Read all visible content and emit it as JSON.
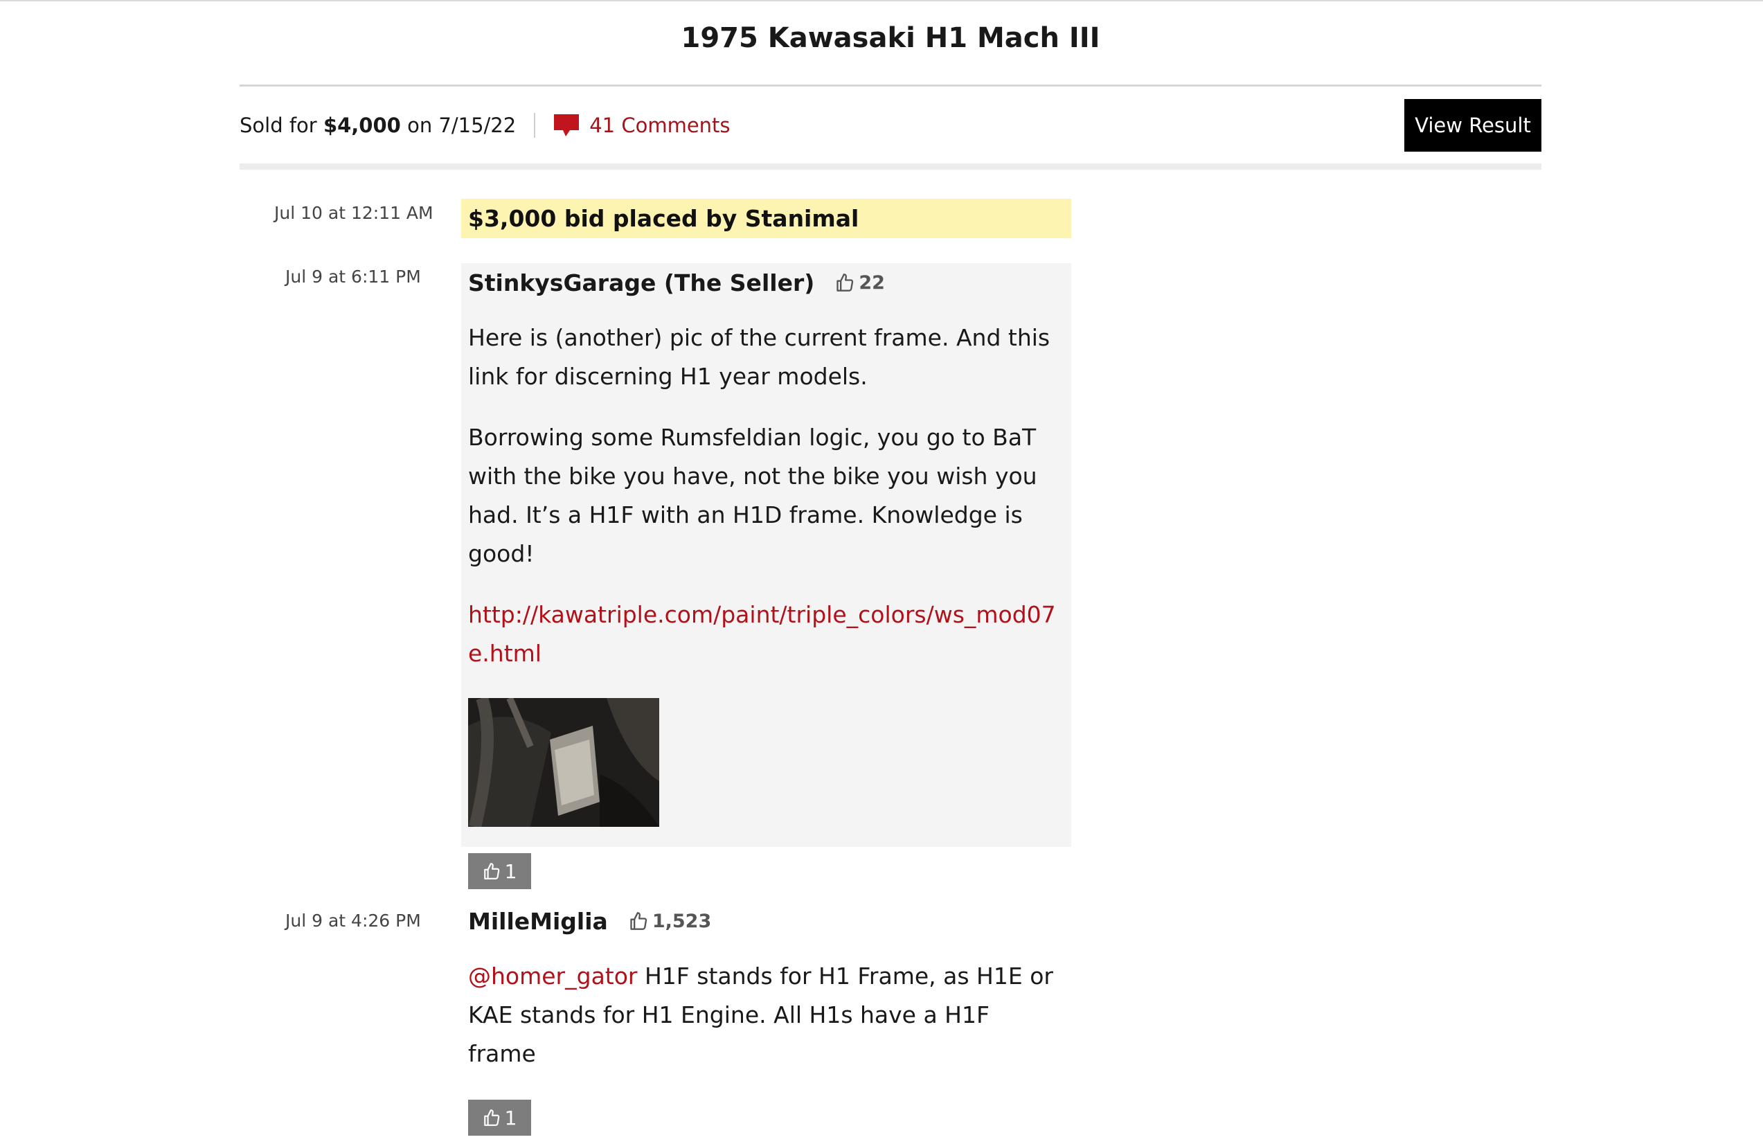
{
  "listing": {
    "title": "1975 Kawasaki H1 Mach III"
  },
  "result_bar": {
    "sold_prefix": "Sold for",
    "sold_price": "$4,000",
    "sold_on": "on 7/15/22",
    "comments_link": "41 Comments",
    "view_result_label": "View Result"
  },
  "bid_entry": {
    "time": "Jul 10 at 12:11 AM",
    "text": "$3,000 bid placed by Stanimal"
  },
  "comments": [
    {
      "time": "Jul 9 at 6:11 PM",
      "author": "StinkysGarage (The Seller)",
      "reputation": "22",
      "paragraph_1": "Here is (another) pic of the current frame. And this link for discerning H1 year models.",
      "paragraph_2": "Borrowing some Rumsfeldian logic, you go to BaT with the bike you have, not the bike you wish you had. It’s a H1F with an H1D frame. Knowledge is good!",
      "link": "http://kawatriple.com/paint/triple_colors/ws_mod07e.html",
      "likes": "1"
    },
    {
      "time": "Jul 9 at 4:26 PM",
      "author": "MilleMiglia",
      "reputation": "1,523",
      "mention": "@homer_gator",
      "text": " H1F stands for H1 Frame, as H1E or KAE stands for H1 Engine. All H1s have a H1F frame",
      "likes": "1"
    }
  ],
  "colors": {
    "accent_red": "#a3141c",
    "bid_highlight": "#fdf4b2",
    "comment_bg": "#f4f4f4",
    "like_button": "#7d7d7d"
  },
  "icons": [
    "comment-bubble-icon",
    "thumbs-up-icon"
  ]
}
